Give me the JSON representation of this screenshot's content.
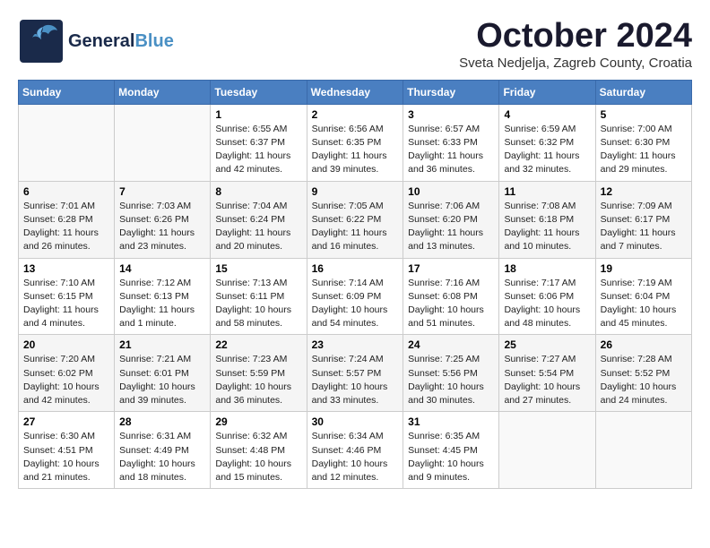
{
  "header": {
    "logo_general": "General",
    "logo_blue": "Blue",
    "month": "October 2024",
    "location": "Sveta Nedjelja, Zagreb County, Croatia"
  },
  "weekdays": [
    "Sunday",
    "Monday",
    "Tuesday",
    "Wednesday",
    "Thursday",
    "Friday",
    "Saturday"
  ],
  "weeks": [
    [
      {
        "day": "",
        "lines": []
      },
      {
        "day": "",
        "lines": []
      },
      {
        "day": "1",
        "lines": [
          "Sunrise: 6:55 AM",
          "Sunset: 6:37 PM",
          "Daylight: 11 hours",
          "and 42 minutes."
        ]
      },
      {
        "day": "2",
        "lines": [
          "Sunrise: 6:56 AM",
          "Sunset: 6:35 PM",
          "Daylight: 11 hours",
          "and 39 minutes."
        ]
      },
      {
        "day": "3",
        "lines": [
          "Sunrise: 6:57 AM",
          "Sunset: 6:33 PM",
          "Daylight: 11 hours",
          "and 36 minutes."
        ]
      },
      {
        "day": "4",
        "lines": [
          "Sunrise: 6:59 AM",
          "Sunset: 6:32 PM",
          "Daylight: 11 hours",
          "and 32 minutes."
        ]
      },
      {
        "day": "5",
        "lines": [
          "Sunrise: 7:00 AM",
          "Sunset: 6:30 PM",
          "Daylight: 11 hours",
          "and 29 minutes."
        ]
      }
    ],
    [
      {
        "day": "6",
        "lines": [
          "Sunrise: 7:01 AM",
          "Sunset: 6:28 PM",
          "Daylight: 11 hours",
          "and 26 minutes."
        ]
      },
      {
        "day": "7",
        "lines": [
          "Sunrise: 7:03 AM",
          "Sunset: 6:26 PM",
          "Daylight: 11 hours",
          "and 23 minutes."
        ]
      },
      {
        "day": "8",
        "lines": [
          "Sunrise: 7:04 AM",
          "Sunset: 6:24 PM",
          "Daylight: 11 hours",
          "and 20 minutes."
        ]
      },
      {
        "day": "9",
        "lines": [
          "Sunrise: 7:05 AM",
          "Sunset: 6:22 PM",
          "Daylight: 11 hours",
          "and 16 minutes."
        ]
      },
      {
        "day": "10",
        "lines": [
          "Sunrise: 7:06 AM",
          "Sunset: 6:20 PM",
          "Daylight: 11 hours",
          "and 13 minutes."
        ]
      },
      {
        "day": "11",
        "lines": [
          "Sunrise: 7:08 AM",
          "Sunset: 6:18 PM",
          "Daylight: 11 hours",
          "and 10 minutes."
        ]
      },
      {
        "day": "12",
        "lines": [
          "Sunrise: 7:09 AM",
          "Sunset: 6:17 PM",
          "Daylight: 11 hours",
          "and 7 minutes."
        ]
      }
    ],
    [
      {
        "day": "13",
        "lines": [
          "Sunrise: 7:10 AM",
          "Sunset: 6:15 PM",
          "Daylight: 11 hours",
          "and 4 minutes."
        ]
      },
      {
        "day": "14",
        "lines": [
          "Sunrise: 7:12 AM",
          "Sunset: 6:13 PM",
          "Daylight: 11 hours",
          "and 1 minute."
        ]
      },
      {
        "day": "15",
        "lines": [
          "Sunrise: 7:13 AM",
          "Sunset: 6:11 PM",
          "Daylight: 10 hours",
          "and 58 minutes."
        ]
      },
      {
        "day": "16",
        "lines": [
          "Sunrise: 7:14 AM",
          "Sunset: 6:09 PM",
          "Daylight: 10 hours",
          "and 54 minutes."
        ]
      },
      {
        "day": "17",
        "lines": [
          "Sunrise: 7:16 AM",
          "Sunset: 6:08 PM",
          "Daylight: 10 hours",
          "and 51 minutes."
        ]
      },
      {
        "day": "18",
        "lines": [
          "Sunrise: 7:17 AM",
          "Sunset: 6:06 PM",
          "Daylight: 10 hours",
          "and 48 minutes."
        ]
      },
      {
        "day": "19",
        "lines": [
          "Sunrise: 7:19 AM",
          "Sunset: 6:04 PM",
          "Daylight: 10 hours",
          "and 45 minutes."
        ]
      }
    ],
    [
      {
        "day": "20",
        "lines": [
          "Sunrise: 7:20 AM",
          "Sunset: 6:02 PM",
          "Daylight: 10 hours",
          "and 42 minutes."
        ]
      },
      {
        "day": "21",
        "lines": [
          "Sunrise: 7:21 AM",
          "Sunset: 6:01 PM",
          "Daylight: 10 hours",
          "and 39 minutes."
        ]
      },
      {
        "day": "22",
        "lines": [
          "Sunrise: 7:23 AM",
          "Sunset: 5:59 PM",
          "Daylight: 10 hours",
          "and 36 minutes."
        ]
      },
      {
        "day": "23",
        "lines": [
          "Sunrise: 7:24 AM",
          "Sunset: 5:57 PM",
          "Daylight: 10 hours",
          "and 33 minutes."
        ]
      },
      {
        "day": "24",
        "lines": [
          "Sunrise: 7:25 AM",
          "Sunset: 5:56 PM",
          "Daylight: 10 hours",
          "and 30 minutes."
        ]
      },
      {
        "day": "25",
        "lines": [
          "Sunrise: 7:27 AM",
          "Sunset: 5:54 PM",
          "Daylight: 10 hours",
          "and 27 minutes."
        ]
      },
      {
        "day": "26",
        "lines": [
          "Sunrise: 7:28 AM",
          "Sunset: 5:52 PM",
          "Daylight: 10 hours",
          "and 24 minutes."
        ]
      }
    ],
    [
      {
        "day": "27",
        "lines": [
          "Sunrise: 6:30 AM",
          "Sunset: 4:51 PM",
          "Daylight: 10 hours",
          "and 21 minutes."
        ]
      },
      {
        "day": "28",
        "lines": [
          "Sunrise: 6:31 AM",
          "Sunset: 4:49 PM",
          "Daylight: 10 hours",
          "and 18 minutes."
        ]
      },
      {
        "day": "29",
        "lines": [
          "Sunrise: 6:32 AM",
          "Sunset: 4:48 PM",
          "Daylight: 10 hours",
          "and 15 minutes."
        ]
      },
      {
        "day": "30",
        "lines": [
          "Sunrise: 6:34 AM",
          "Sunset: 4:46 PM",
          "Daylight: 10 hours",
          "and 12 minutes."
        ]
      },
      {
        "day": "31",
        "lines": [
          "Sunrise: 6:35 AM",
          "Sunset: 4:45 PM",
          "Daylight: 10 hours",
          "and 9 minutes."
        ]
      },
      {
        "day": "",
        "lines": []
      },
      {
        "day": "",
        "lines": []
      }
    ]
  ]
}
